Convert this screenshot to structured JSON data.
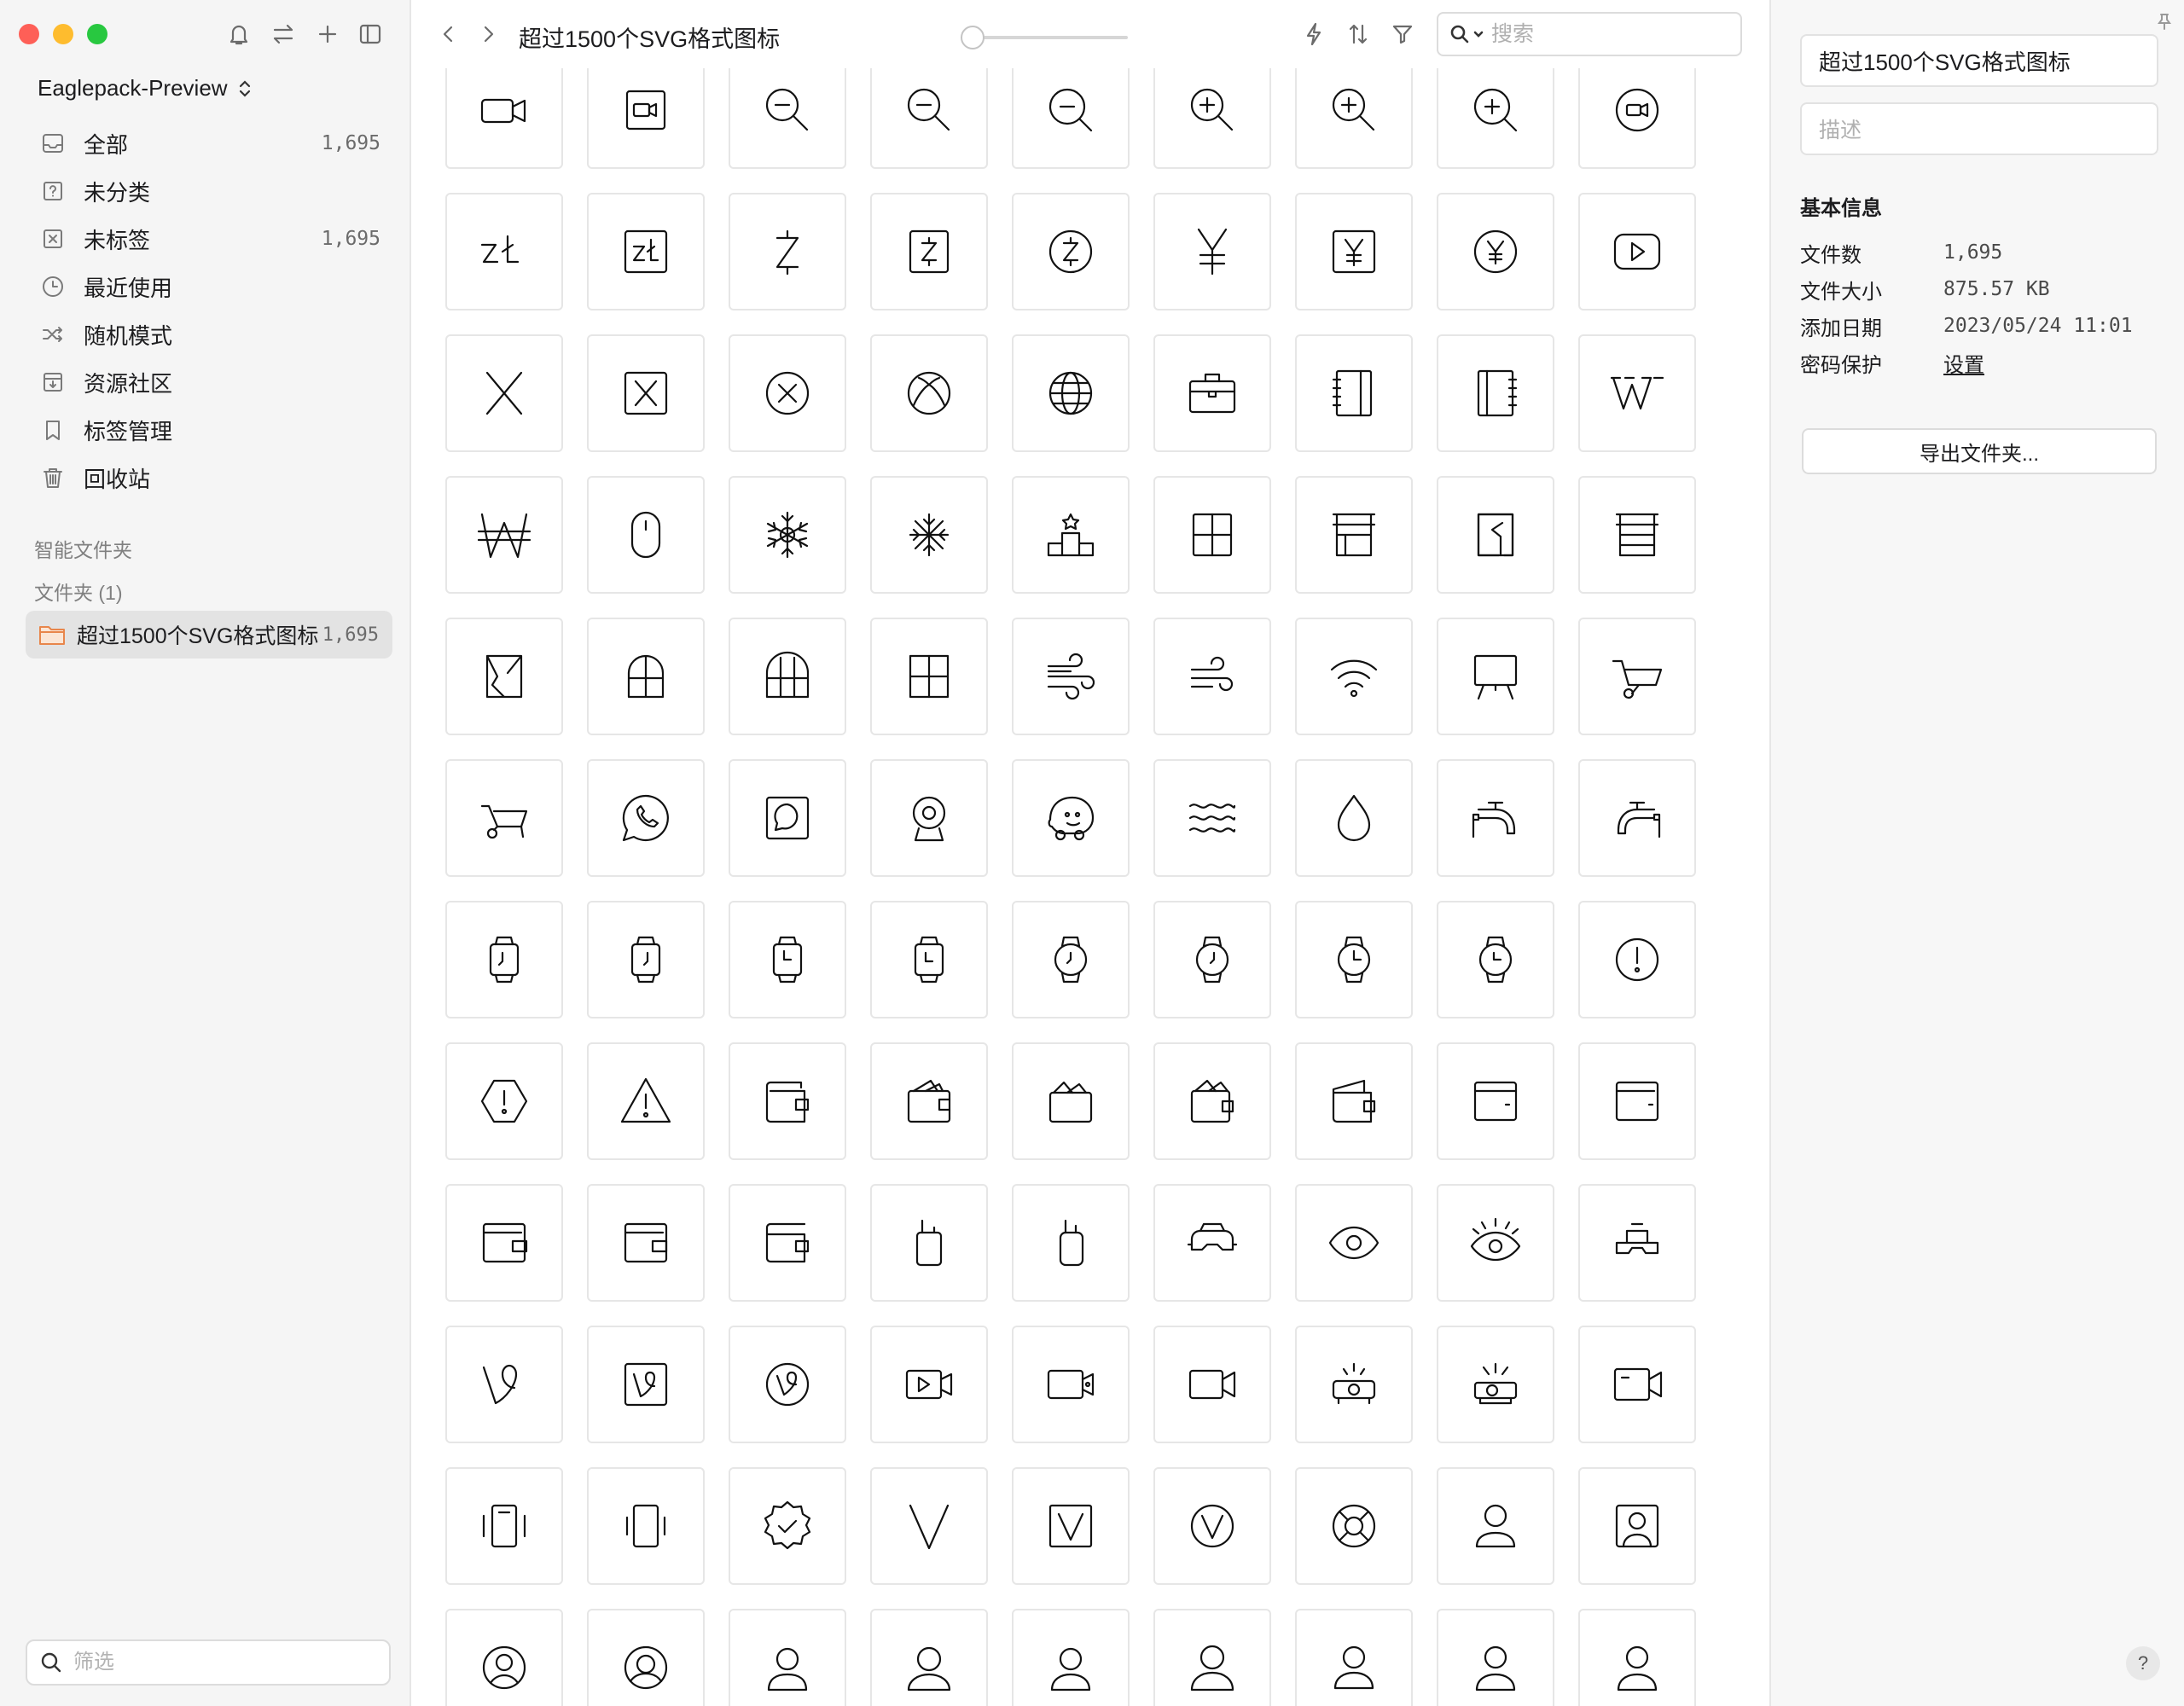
{
  "sidebar": {
    "library_name": "Eaglepack-Preview",
    "items": [
      {
        "label": "全部",
        "count": "1,695",
        "icon": "inbox-icon"
      },
      {
        "label": "未分类",
        "count": "",
        "icon": "question-box-icon"
      },
      {
        "label": "未标签",
        "count": "1,695",
        "icon": "untagged-icon"
      },
      {
        "label": "最近使用",
        "count": "",
        "icon": "clock-icon"
      },
      {
        "label": "随机模式",
        "count": "",
        "icon": "shuffle-icon"
      },
      {
        "label": "资源社区",
        "count": "",
        "icon": "download-box-icon"
      },
      {
        "label": "标签管理",
        "count": "",
        "icon": "bookmark-icon"
      },
      {
        "label": "回收站",
        "count": "",
        "icon": "trash-icon"
      }
    ],
    "smart_folders_title": "智能文件夹",
    "folders_title": "文件夹 (1)",
    "folder": {
      "label": "超过1500个SVG格式图标",
      "count": "1,695"
    },
    "filter_placeholder": "筛选"
  },
  "toolbar": {
    "title": "超过1500个SVG格式图标",
    "search_placeholder": "搜索"
  },
  "grid": {
    "icons": [
      "video-camera",
      "video-box",
      "zoom-out",
      "zoom-out",
      "zoom-out-circle",
      "zoom-in",
      "zoom-in",
      "zoom-in-circle",
      "video-circle",
      "zloty",
      "zloty-box",
      "zcash",
      "zcash-box",
      "zcash-circle",
      "yen",
      "yen-box",
      "yen-circle",
      "youtube",
      "x",
      "x-box",
      "x-circle",
      "xbox",
      "world",
      "work-case",
      "wiki-book",
      "wiki-book-alt",
      "wikipedia",
      "won",
      "mouse",
      "snowflake",
      "snowflake-alt",
      "winners",
      "window",
      "shop-window",
      "window-broken",
      "shop-window-alt",
      "window-broken-alt",
      "window-arch",
      "window-arch-alt",
      "window-frame",
      "wind",
      "wind-alt",
      "wifi",
      "whiteboard",
      "wheelbarrow",
      "wheelbarrow-alt",
      "whatsapp",
      "message-square",
      "webcam",
      "waze",
      "waves",
      "water-drop",
      "water-tap",
      "water-tap-alt",
      "watch",
      "watch-alt",
      "watch-time",
      "watch-time-alt",
      "watch-round",
      "watch-round-alt",
      "watch-round-time",
      "watch-round-time-alt",
      "warning-circle",
      "warning-hexagon",
      "warning-triangle",
      "wallet",
      "wallet-cards",
      "wallet-open",
      "wallet-cards-alt",
      "wallet-alt",
      "wallet-flat",
      "wallet-flat-alt",
      "wallet-solid",
      "wallet-stripe",
      "wallet-stripe-alt",
      "walkie-talkie",
      "walkie-talkie-alt",
      "vr-glasses",
      "eye",
      "eye-alert",
      "vr-headset",
      "vine",
      "vine-box",
      "vine-circle",
      "video-play",
      "video-record",
      "video-camera-alt",
      "projector",
      "projector-alt",
      "video-box-alt",
      "vibrate",
      "vibrate-alt",
      "verified",
      "v-letter",
      "v-box",
      "v-circle",
      "lifebuoy",
      "user",
      "user-square",
      "user-circle",
      "user-circle-alt",
      "user-a",
      "user-b",
      "user-c",
      "user-d",
      "user-e",
      "user-f",
      "user-g"
    ]
  },
  "inspector": {
    "name": "超过1500个SVG格式图标",
    "desc_placeholder": "描述",
    "basic_info_title": "基本信息",
    "rows": [
      {
        "label": "文件数",
        "value": "1,695"
      },
      {
        "label": "文件大小",
        "value": "875.57 KB"
      },
      {
        "label": "添加日期",
        "value": "2023/05/24 11:01"
      },
      {
        "label": "密码保护",
        "value": "设置"
      }
    ],
    "export_label": "导出文件夹...",
    "help_label": "?"
  },
  "colors": {
    "traffic_red": "#fe5f57",
    "traffic_yellow": "#febc2e",
    "traffic_green": "#28c840",
    "folder_orange": "#e8864b",
    "selected_bg": "#e3e3e3"
  }
}
